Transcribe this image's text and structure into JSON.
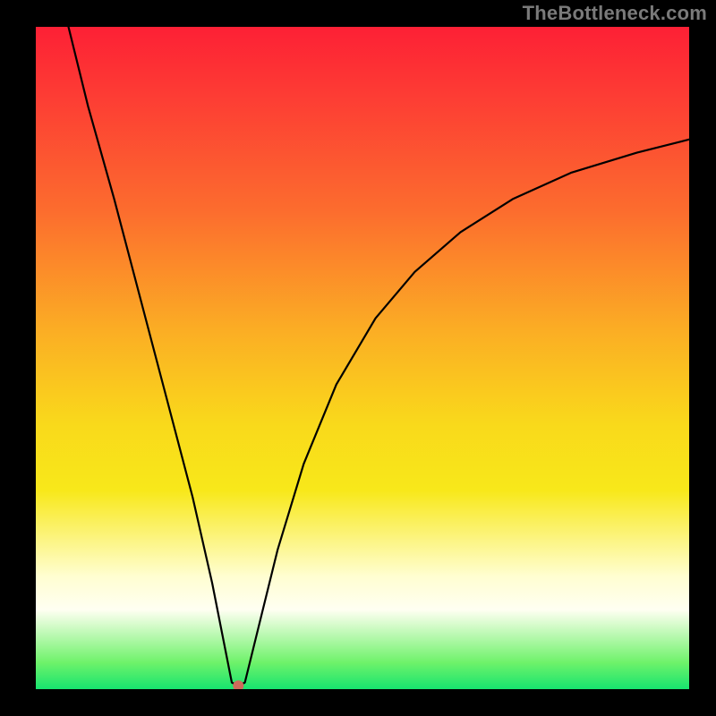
{
  "watermark": "TheBottleneck.com",
  "chart_data": {
    "type": "line",
    "title": "",
    "xlabel": "",
    "ylabel": "",
    "xlim": [
      0,
      100
    ],
    "ylim": [
      0,
      100
    ],
    "grid": false,
    "series": [
      {
        "name": "curve",
        "x": [
          5,
          8,
          12,
          16,
          20,
          24,
          27,
          29,
          30,
          31,
          32,
          34,
          37,
          41,
          46,
          52,
          58,
          65,
          73,
          82,
          92,
          100
        ],
        "y": [
          100,
          88,
          74,
          59,
          44,
          29,
          16,
          6,
          1,
          0.5,
          1,
          9,
          21,
          34,
          46,
          56,
          63,
          69,
          74,
          78,
          81,
          83
        ]
      }
    ],
    "marker": {
      "name": "optimal-point",
      "x": 31,
      "y": 0.5
    },
    "background_gradient": {
      "top": "#fd2035",
      "mid": "#f9d91b",
      "bottom": "#17e46f"
    }
  }
}
